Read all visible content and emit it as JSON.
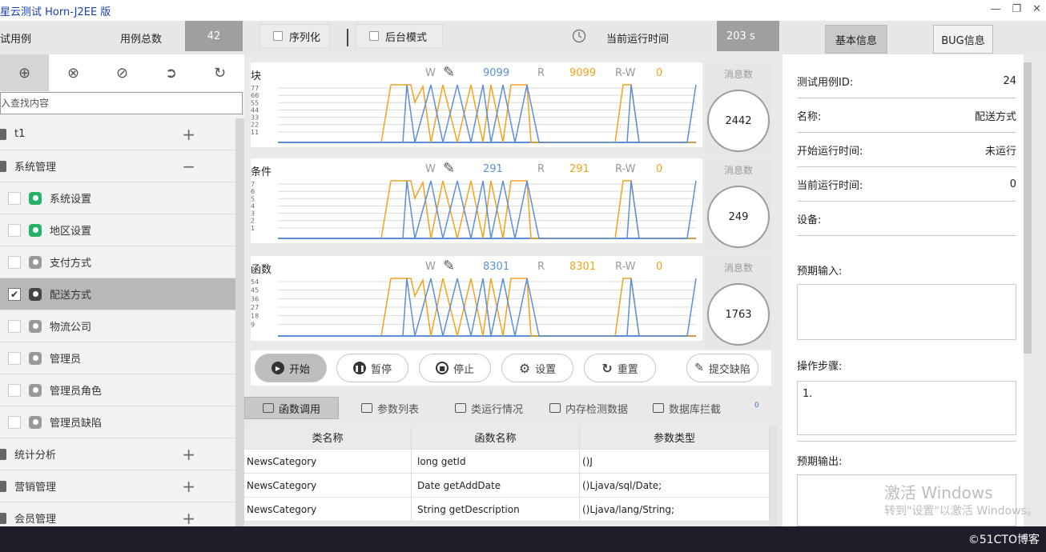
{
  "window": {
    "title": "星云测试 Horn-J2EE 版"
  },
  "header": {
    "cases_label": "试用例",
    "total_label": "用例总数",
    "total_value": "42",
    "serialize_label": "序列化",
    "background_label": "后台模式",
    "runtime_label": "当前运行时间",
    "runtime_value": "203 s",
    "tab_basic": "基本信息",
    "tab_bug": "BUG信息"
  },
  "sidebar": {
    "search_placeholder": "入查找内容",
    "items": [
      {
        "label": "t1",
        "type": "group",
        "expand": "+"
      },
      {
        "label": "系统管理",
        "type": "group",
        "expand": "−"
      },
      {
        "label": "系统设置",
        "type": "case",
        "icon": "green"
      },
      {
        "label": "地区设置",
        "type": "case",
        "icon": "green"
      },
      {
        "label": "支付方式",
        "type": "case",
        "icon": "gray"
      },
      {
        "label": "配送方式",
        "type": "case",
        "icon": "dark",
        "checked": true
      },
      {
        "label": "物流公司",
        "type": "case",
        "icon": "gray"
      },
      {
        "label": "管理员",
        "type": "case",
        "icon": "gray"
      },
      {
        "label": "管理员角色",
        "type": "case",
        "icon": "gray"
      },
      {
        "label": "管理员缺陷",
        "type": "case",
        "icon": "gray"
      },
      {
        "label": "统计分析",
        "type": "group",
        "expand": "+"
      },
      {
        "label": "营销管理",
        "type": "group",
        "expand": "+"
      },
      {
        "label": "会员管理",
        "type": "group",
        "expand": "+"
      }
    ]
  },
  "charts": [
    {
      "title": "块",
      "w_label": "W",
      "w_value": "9099",
      "r_label": "R",
      "r_value": "9099",
      "rw_label": "R-W",
      "rw_value": "0",
      "msg_label": "消息数",
      "msg_value": "2442",
      "ticks": [
        "77",
        "66",
        "55",
        "44",
        "33",
        "22",
        "11"
      ]
    },
    {
      "title": "条件",
      "w_label": "W",
      "w_value": "291",
      "r_label": "R",
      "r_value": "291",
      "rw_label": "R-W",
      "rw_value": "0",
      "msg_label": "消息数",
      "msg_value": "249",
      "ticks": [
        "7",
        "6",
        "5",
        "4",
        "3",
        "2",
        "1"
      ]
    },
    {
      "title": "函数",
      "w_label": "W",
      "w_value": "8301",
      "r_label": "R",
      "r_value": "8301",
      "rw_label": "R-W",
      "rw_value": "0",
      "msg_label": "消息数",
      "msg_value": "1763",
      "ticks": [
        "54",
        "45",
        "36",
        "27",
        "18",
        "9"
      ]
    }
  ],
  "controls": {
    "start": "开始",
    "pause": "暂停",
    "stop": "停止",
    "settings": "设置",
    "reset": "重置",
    "submit_defect": "提交缺陷"
  },
  "bottom_tabs": {
    "tabs": [
      "函数调用",
      "参数列表",
      "类运行情况",
      "内存检测数据",
      "数据库拦截"
    ],
    "badge": "0"
  },
  "table": {
    "headers": [
      "类名称",
      "函数名称",
      "参数类型"
    ],
    "rows": [
      [
        "NewsCategory",
        "long getId",
        "()J"
      ],
      [
        "NewsCategory",
        "Date getAddDate",
        "()Ljava/sql/Date;"
      ],
      [
        "NewsCategory",
        "String getDescription",
        "()Ljava/lang/String;"
      ]
    ]
  },
  "info": {
    "case_id_label": "测试用例ID:",
    "case_id_value": "24",
    "name_label": "名称:",
    "name_value": "配送方式",
    "start_label": "开始运行时间:",
    "start_value": "未运行",
    "current_label": "当前运行时间:",
    "current_value": "0",
    "device_label": "设备:",
    "expected_input_label": "预期输入:",
    "steps_label": "操作步骤:",
    "steps_value": "1.",
    "expected_output_label": "预期输出:"
  },
  "watermark": {
    "line1": "激活 Windows",
    "line2": "转到\"设置\"以激活 Windows。"
  },
  "taskbar": {
    "brand": "©51CTO博客"
  },
  "colors": {
    "blue_series": "#5b8fd6",
    "orange_series": "#f3a21a"
  }
}
